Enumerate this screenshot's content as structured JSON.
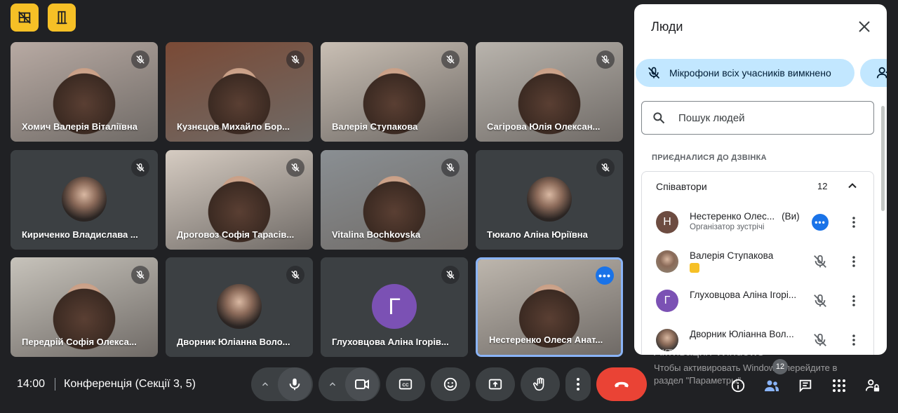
{
  "top_actions": [
    {
      "icon": "layout-off-icon"
    },
    {
      "icon": "door-exit-icon"
    }
  ],
  "tiles": [
    {
      "name": "Хомич Валерія Віталіївна",
      "type": "video",
      "bg": "#b8aaa3",
      "muted": true
    },
    {
      "name": "Кузнєцов Михайло Бор...",
      "type": "video",
      "bg": "#7a4a36",
      "muted": true
    },
    {
      "name": "Валерія Ступакова",
      "type": "video",
      "bg": "#c9bfb4",
      "muted": true
    },
    {
      "name": "Сагірова Юлія Олексан...",
      "type": "video",
      "bg": "#b9b4ad",
      "muted": true
    },
    {
      "name": "Кириченко Владислава ...",
      "type": "photo",
      "bg": "#3c4043",
      "muted": true
    },
    {
      "name": "Дроговоз Софія Тарасів...",
      "type": "video",
      "bg": "#d6ccc2",
      "muted": true
    },
    {
      "name": "Vitalina Bochkovska",
      "type": "video",
      "bg": "#8a8f93",
      "muted": true
    },
    {
      "name": "Тюкало Аліна Юріївна",
      "type": "photo",
      "bg": "#3c4043",
      "muted": true
    },
    {
      "name": "Передрій Софія Олекса...",
      "type": "video",
      "bg": "#c7c3bb",
      "muted": true
    },
    {
      "name": "Дворник Юліанна Воло...",
      "type": "photo",
      "bg": "#3c4043",
      "muted": true
    },
    {
      "name": "Глуховцова Аліна Ігорів...",
      "type": "letter",
      "letter": "Г",
      "bg": "#3c4043",
      "muted": true
    },
    {
      "name": "Нестеренко Олеся Анат...",
      "type": "video",
      "bg": "#bdb6ad",
      "muted": false,
      "active": true
    }
  ],
  "panel": {
    "title": "Люди",
    "mute_all": "Мікрофони всіх учасників вимкнено",
    "search_placeholder": "Пошук людей",
    "joined_heading": "ПРИЄДНАЛИСЯ ДО ДЗВІНКА",
    "contributors_label": "Співавтори",
    "contributors_count": "12",
    "people": [
      {
        "name": "Нестеренко Олес...",
        "you": "(Ви)",
        "role": "Організатор зустрічі",
        "avatar_letter": "Н",
        "avatar_color": "#6d4c41",
        "action": "more-blue"
      },
      {
        "name": "Валерія Ступакова",
        "role": "",
        "avatar_letter": "",
        "avatar_color": "#8d7b6a",
        "action": "mic-off"
      },
      {
        "name": "Глуховцова Аліна Ігорі...",
        "role": "",
        "avatar_letter": "Г",
        "avatar_color": "#7b51b4",
        "action": "mic-off"
      },
      {
        "name": "Дворник Юліанна Вол...",
        "role": "",
        "avatar_letter": "",
        "avatar_color": "#333",
        "action": "mic-off"
      }
    ]
  },
  "bottom": {
    "time": "14:00",
    "meeting": "Конференція (Секції 3, 5)",
    "people_badge": "12"
  },
  "watermark": {
    "title": "Активация Windows",
    "line1": "Чтобы активировать Windows, перейдите в",
    "line2": "раздел \"Параметры\"."
  },
  "colors": {
    "background": "#202124",
    "tile": "#3c4043",
    "accent_blue": "#1a73e8",
    "end_call": "#ea4335",
    "top_button": "#f6c026",
    "pill": "#c2e7ff"
  }
}
